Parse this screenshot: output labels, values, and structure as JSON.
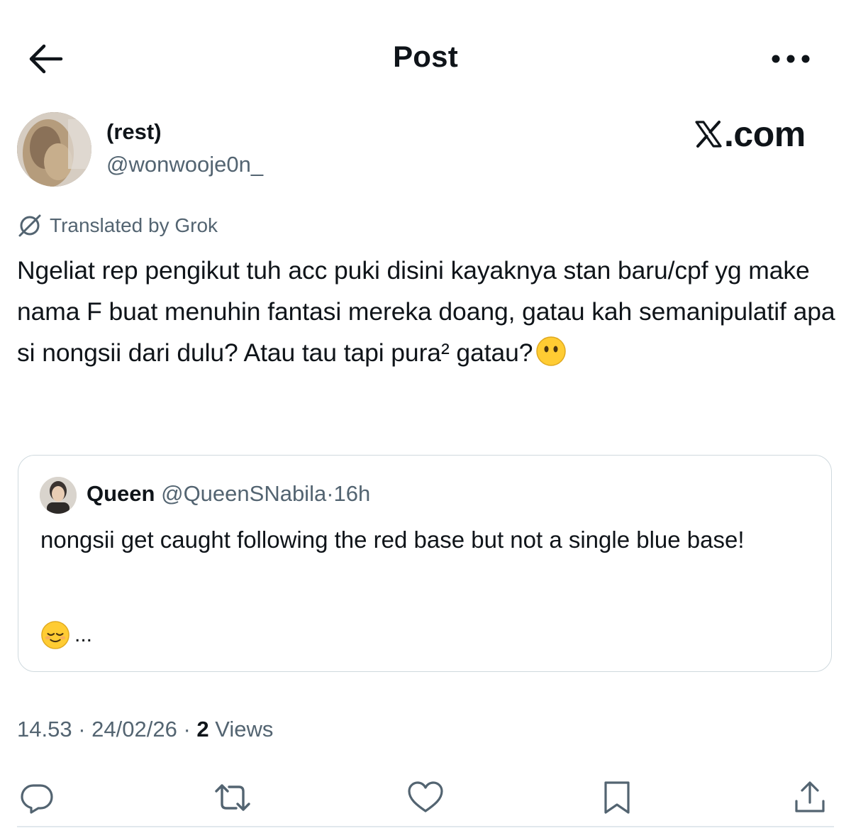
{
  "header": {
    "title": "Post",
    "back_icon": "arrow-left-icon",
    "more_icon": "more-horizontal-icon"
  },
  "author": {
    "display_name": "(rest)",
    "handle": "@wonwooje0n_"
  },
  "watermark": {
    "text": ".com"
  },
  "translation": {
    "label": "Translated by Grok"
  },
  "post": {
    "text": "Ngeliat rep pengikut tuh acc puki disini kayaknya stan baru/cpf yg make nama F buat menuhin fantasi mereka doang, gatau kah semanipulatif apa si nongsii dari dulu? Atau tau tapi pura² gatau?",
    "emoji": "face-without-mouth"
  },
  "quote": {
    "name": "Queen",
    "handle": "@QueenSNabila",
    "separator": "·",
    "time": "16h",
    "text": "nongsii get caught following the red base but not a single blue base!",
    "tail_emoji": "relieved-face",
    "tail_text": "..."
  },
  "meta": {
    "time": "14.53",
    "sep1": "·",
    "date": "24/02/26",
    "sep2": "·",
    "views_count": "2",
    "views_label": "Views"
  },
  "actions": [
    "reply-icon",
    "repost-icon",
    "like-icon",
    "bookmark-icon",
    "share-icon"
  ],
  "colors": {
    "text_primary": "#0f1419",
    "text_secondary": "#536471",
    "icon_gray": "#536471",
    "border": "#cfd9de",
    "emoji_yellow": "#ffcc33"
  }
}
